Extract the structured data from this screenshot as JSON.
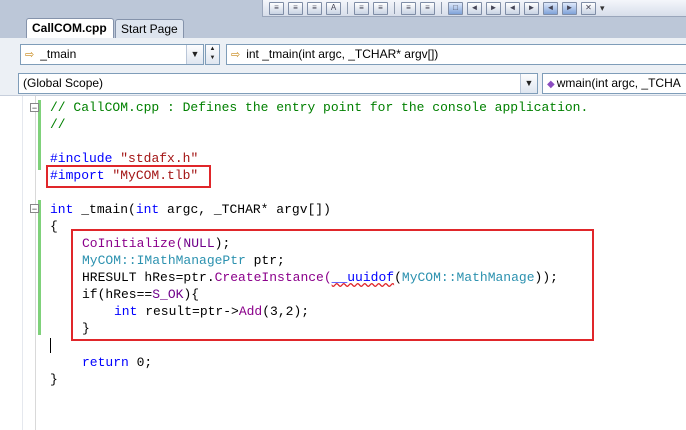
{
  "toolbar": {
    "buttons": [
      "comment-icon",
      "uncomment-icon",
      "indent-icon",
      "outdent-icon",
      "format-icon",
      "align-left-icon",
      "align-right-icon",
      "bookmark-icon",
      "prev-icon",
      "next-icon",
      "nav-back-icon",
      "nav-forward-icon",
      "stop-icon",
      "overflow-icon"
    ]
  },
  "tabs": [
    {
      "label": "CallCOM.cpp",
      "active": true
    },
    {
      "label": "Start Page",
      "active": false
    }
  ],
  "nav": {
    "left_combo": "_tmain",
    "right_combo": "int _tmain(int argc, _TCHAR* argv[])",
    "scope_combo": "(Global Scope)",
    "member_combo": "wmain(int argc, _TCHA"
  },
  "code": {
    "l1": "// CallCOM.cpp : Defines the entry point for the console application.",
    "l2": "//",
    "l4a": "#include",
    "l4b": "\"stdafx.h\"",
    "l5a": "#import",
    "l5b": "\"MyCOM.tlb\"",
    "l7a": "int",
    "l7b": "_tmain(",
    "l7c": "int",
    "l7d": "argc,",
    "l7e": "_TCHAR*",
    "l7f": "argv[])",
    "l8": "{",
    "l9a": "CoInitialize(",
    "l9b": "NULL",
    "l9c": ");",
    "l10a": "MyCOM::IMathManagePtr",
    "l10b": " ptr;",
    "l11a": "HRESULT hRes=ptr.",
    "l11b": "CreateInstance(",
    "l11c": "__uuidof",
    "l11d": "(",
    "l11e": "MyCOM::MathManage",
    "l11f": "));",
    "l12a": "if(hRes==",
    "l12b": "S_OK",
    "l12c": "){",
    "l13a": "int",
    "l13b": " result=ptr->",
    "l13c": "Add",
    "l13d": "(3,2);",
    "l14": "}",
    "l16a": "return",
    "l16b": " 0;",
    "l17": "}"
  },
  "colors": {
    "highlight_box": "#e0262a",
    "keyword": "#0000ff",
    "comment": "#008000",
    "string": "#a31515",
    "change_bar": "#7fd17a"
  }
}
